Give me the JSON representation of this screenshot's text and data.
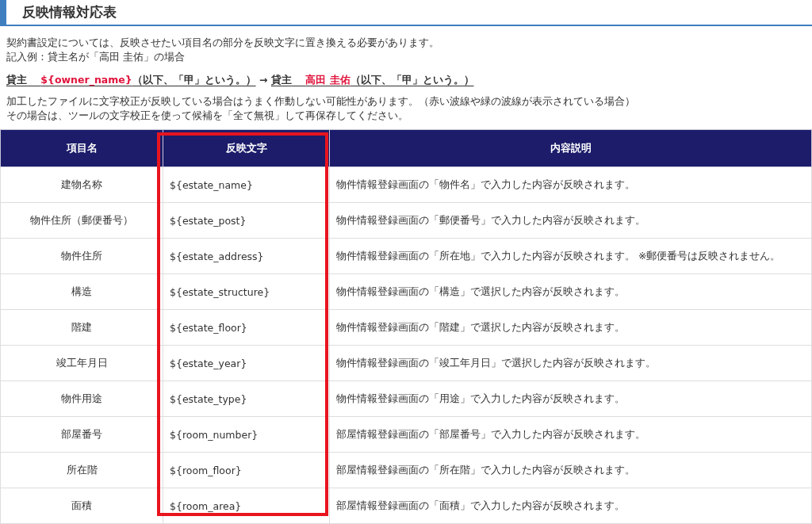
{
  "heading": "反映情報対応表",
  "intro": [
    "契約書設定については、反映させたい項目名の部分を反映文字に置き換える必要があります。",
    "記入例：貸主名が「高田 圭佑」の場合"
  ],
  "example": {
    "before": {
      "label": "貸主",
      "value": "${owner_name}",
      "suffix": "（以下、「甲」という。）"
    },
    "arrow": "→",
    "after": {
      "label": "貸主",
      "value": "高田 圭佑",
      "suffix": "（以下、「甲」という。）"
    }
  },
  "notes": [
    "加工したファイルに文字校正が反映している場合はうまく作動しない可能性があります。（赤い波線や緑の波線が表示されている場合）",
    "その場合は、ツールの文字校正を使って候補を「全て無視」して再保存してください。"
  ],
  "table": {
    "columns": [
      {
        "label": "項目名",
        "highlighted": false
      },
      {
        "label": "反映文字",
        "highlighted": true
      },
      {
        "label": "内容説明",
        "highlighted": false
      }
    ],
    "rows": [
      [
        "建物名称",
        "${estate_name}",
        "物件情報登録画面の「物件名」で入力した内容が反映されます。"
      ],
      [
        "物件住所（郵便番号）",
        "${estate_post}",
        "物件情報登録画面の「郵便番号」で入力した内容が反映されます。"
      ],
      [
        "物件住所",
        "${estate_address}",
        "物件情報登録画面の「所在地」で入力した内容が反映されます。 ※郵便番号は反映されません。"
      ],
      [
        "構造",
        "${estate_structure}",
        "物件情報登録画面の「構造」で選択した内容が反映されます。"
      ],
      [
        "階建",
        "${estate_floor}",
        "物件情報登録画面の「階建」で選択した内容が反映されます。"
      ],
      [
        "竣工年月日",
        "${estate_year}",
        "物件情報登録画面の「竣工年月日」で選択した内容が反映されます。"
      ],
      [
        "物件用途",
        "${estate_type}",
        "物件情報登録画面の「用途」で入力した内容が反映されます。"
      ],
      [
        "部屋番号",
        "${room_number}",
        "部屋情報登録画面の「部屋番号」で入力した内容が反映されます。"
      ],
      [
        "所在階",
        "${room_floor}",
        "部屋情報登録画面の「所在階」で入力した内容が反映されます。"
      ],
      [
        "面積",
        "${room_area}",
        "部屋情報登録画面の「面積」で入力した内容が反映されます。"
      ]
    ]
  }
}
